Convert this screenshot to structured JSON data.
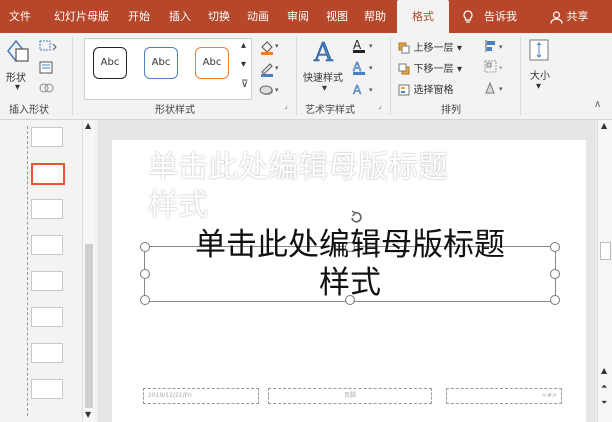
{
  "tabs": {
    "file": "文件",
    "master": "幻灯片母版",
    "home": "开始",
    "insert": "插入",
    "transitions": "切换",
    "animations": "动画",
    "review": "审阅",
    "view": "视图",
    "help": "帮助",
    "format": "格式",
    "tell_me": "告诉我",
    "share": "共享"
  },
  "ribbon": {
    "insert_shapes": {
      "shapes_label": "形状",
      "group": "插入形状"
    },
    "shape_styles": {
      "samples": [
        "Abc",
        "Abc",
        "Abc"
      ],
      "group": "形状样式"
    },
    "wordart": {
      "quick_styles": "快速样式",
      "group": "艺术字样式"
    },
    "arrange": {
      "bring_forward": "上移一层",
      "send_backward": "下移一层",
      "selection_pane": "选择窗格",
      "group": "排列"
    },
    "size": {
      "label": "大小"
    }
  },
  "slide": {
    "ghost_title_line1": "单击此处编辑母版标题",
    "ghost_title_line2": "样式",
    "title_line1": "单击此处编辑母版标题",
    "title_line2": "样式",
    "footer_date": "2019/12/21/Fri",
    "footer_mid": "页脚",
    "footer_num": "<#>"
  },
  "colors": {
    "tab_bar": "#b7472a",
    "ribbon": "#f3f3f3",
    "slide": "#ffffff",
    "thumb_selected": "#e8572a",
    "style_black": "#222222",
    "style_blue": "#4a7fc1",
    "style_orange": "#ed7d31"
  }
}
